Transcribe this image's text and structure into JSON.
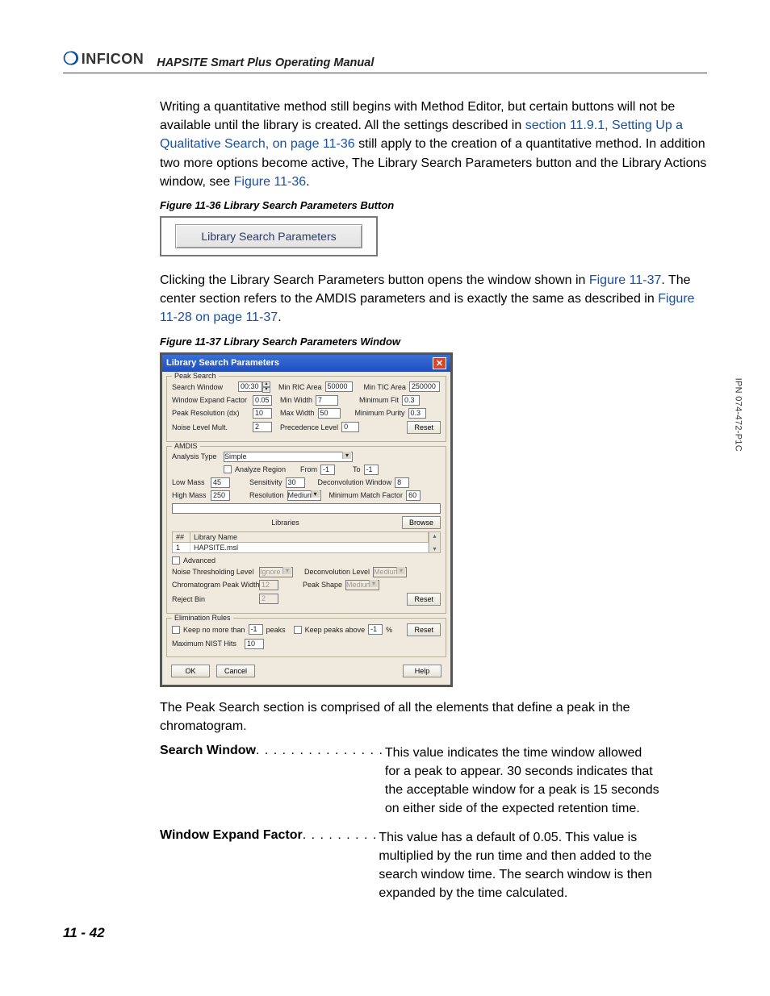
{
  "header": {
    "brand": "INFICON",
    "doc_title": "HAPSITE Smart Plus Operating Manual"
  },
  "para1": {
    "t1": "Writing a quantitative method still begins with Method Editor, but certain buttons will not be available until the library is created. All the settings described in ",
    "l1": "section 11.9.1, Setting Up a Qualitative Search, on page 11-36",
    "t2": " still apply to the creation of a quantitative method. In addition two more options become active, The Library Search Parameters button and the Library Actions window, see ",
    "l2": "Figure 11-36",
    "t3": "."
  },
  "fig36_cap": "Figure 11-36  Library Search Parameters Button",
  "fig36_btn": "Library Search Parameters",
  "para2": {
    "t1": "Clicking the Library Search Parameters button opens the window shown in ",
    "l1": "Figure 11-37",
    "t2": ". The center section refers to the AMDIS parameters and is exactly the same as described in ",
    "l2": "Figure 11-28 on page 11-37",
    "t3": "."
  },
  "fig37_cap": "Figure 11-37  Library Search Parameters Window",
  "dlg": {
    "title": "Library Search Parameters",
    "peak": {
      "legend": "Peak Search",
      "search_window_l": "Search Window",
      "search_window_v": "00:30",
      "min_ric_l": "Min RIC Area",
      "min_ric_v": "50000",
      "min_tic_l": "Min TIC Area",
      "min_tic_v": "250000",
      "wef_l": "Window Expand Factor",
      "wef_v": "0.05",
      "minw_l": "Min Width",
      "minw_v": "7",
      "minfit_l": "Minimum Fit",
      "minfit_v": "0.3",
      "pres_l": "Peak Resolution (dx)",
      "pres_v": "10",
      "maxw_l": "Max Width",
      "maxw_v": "50",
      "minp_l": "Minimum Purity",
      "minp_v": "0.3",
      "noise_l": "Noise Level Mult.",
      "noise_v": "2",
      "prec_l": "Precedence Level",
      "prec_v": "0",
      "reset": "Reset"
    },
    "amdis": {
      "legend": "AMDIS",
      "atype_l": "Analysis Type",
      "atype_v": "Simple",
      "areg_l": "Analyze Region",
      "from_l": "From",
      "from_v": "-1",
      "to_l": "To",
      "to_v": "-1",
      "lowm_l": "Low Mass",
      "lowm_v": "45",
      "sens_l": "Sensitivity",
      "sens_v": "30",
      "dw_l": "Deconvolution Window",
      "dw_v": "8",
      "highm_l": "High Mass",
      "highm_v": "250",
      "res_l": "Resolution",
      "res_v": "Medium",
      "mmf_l": "Minimum Match Factor",
      "mmf_v": "60",
      "libs_l": "Libraries",
      "browse": "Browse",
      "th_idx": "##",
      "th_name": "Library Name",
      "tr_idx": "1",
      "tr_name": "HAPSITE.msl",
      "adv_l": "Advanced",
      "ntl_l": "Noise Thresholding Level",
      "ntl_v": "Ignore",
      "dlv_l": "Deconvolution Level",
      "dlv_v": "Medium",
      "cpw_l": "Chromatogram Peak Width",
      "cpw_v": "12",
      "psh_l": "Peak Shape",
      "psh_v": "Medium",
      "rej_l": "Reject Bin",
      "rej_v": "2",
      "reset": "Reset"
    },
    "elim": {
      "legend": "Elimination Rules",
      "knmt_l": "Keep no more than",
      "knmt_v": "-1",
      "peaks_l": "peaks",
      "kpa_l": "Keep peaks above",
      "kpa_v": "-1",
      "pct": "%",
      "reset": "Reset",
      "mnh_l": "Maximum NIST Hits",
      "mnh_v": "10"
    },
    "footer": {
      "ok": "OK",
      "cancel": "Cancel",
      "help": "Help"
    }
  },
  "para3": "The Peak Search section is comprised of all the elements that define a peak in the chromatogram.",
  "defs": [
    {
      "term": "Search Window",
      "dots": " . . . . . . . . . . . . . . . ",
      "desc": "This value indicates the time window allowed for a peak to appear. 30 seconds indicates that the acceptable window for a peak is 15 seconds on either side of the expected retention time."
    },
    {
      "term": "Window Expand Factor",
      "dots": " . . . . . . . . . ",
      "desc": "This value has a default of 0.05. This value is multiplied by the run time and then added to the search window time. The search window is then expanded by the time calculated."
    }
  ],
  "pagenum": "11 - 42",
  "sidetext": "IPN 074-472-P1C"
}
